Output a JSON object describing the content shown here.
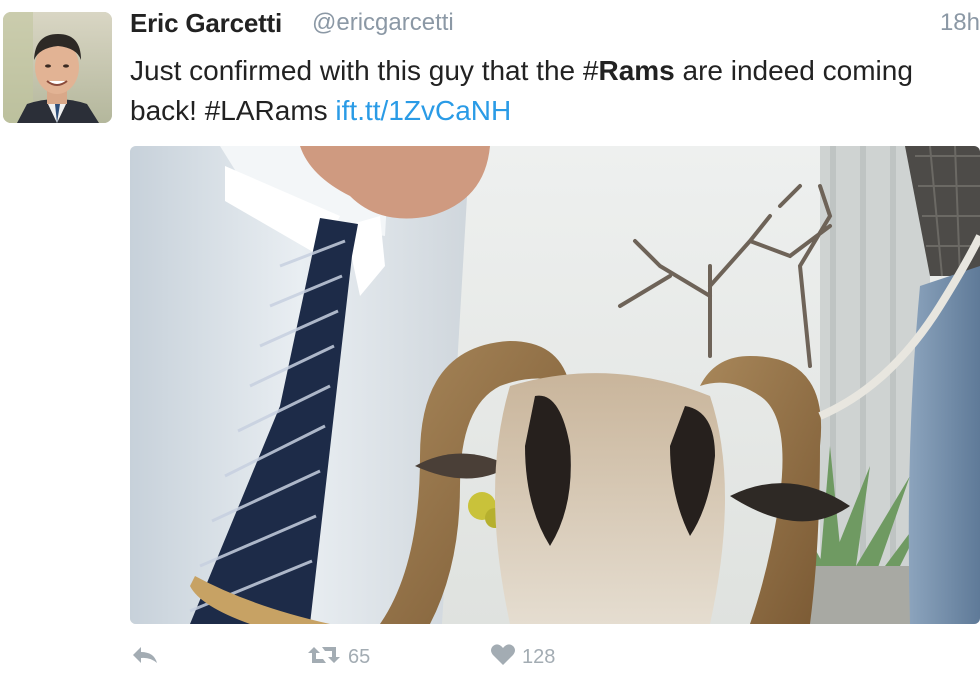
{
  "tweet": {
    "author_name": "Eric Garcetti",
    "author_handle": "@ericgarcetti",
    "timestamp": "18h",
    "text": {
      "part1": "Just confirmed with this guy that the ",
      "hashtag_prefix": "#",
      "hashtag_bold": "Rams",
      "part2": " are indeed coming back! #LARams ",
      "link": "ift.tt/1ZvCaNH"
    },
    "media": {
      "description_icon": "photo-ram-icon"
    },
    "actions": {
      "reply_icon": "reply-icon",
      "retweet_icon": "retweet-icon",
      "retweet_count": "65",
      "like_icon": "heart-icon",
      "like_count": "128"
    }
  },
  "colors": {
    "link": "#2a9be6",
    "muted": "#8b98a5",
    "action": "#a3acb3"
  }
}
